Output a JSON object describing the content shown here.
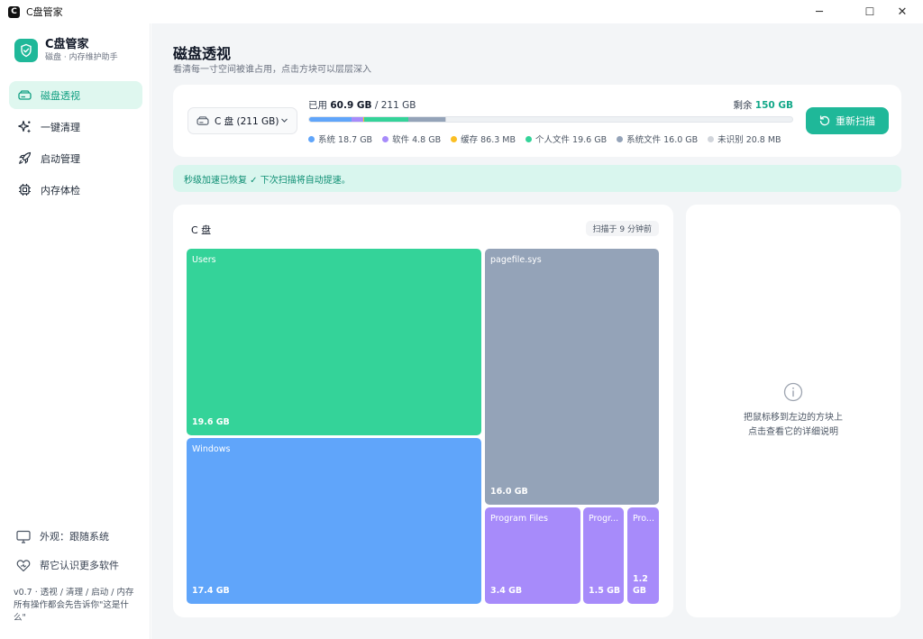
{
  "window": {
    "title": "C盘管家",
    "app_icon": "C",
    "controls": {
      "minimize": "─",
      "maximize": "☐",
      "close": "✕"
    }
  },
  "brand": {
    "name": "C盘管家",
    "subtitle": "磁盘 · 内存维护助手",
    "logo_icon": "shield-check-icon",
    "accent": "#1fb899"
  },
  "sidebar": {
    "items": [
      {
        "label": "磁盘透视",
        "icon": "drive-icon",
        "active": true
      },
      {
        "label": "一键清理",
        "icon": "sparkle-icon",
        "active": false
      },
      {
        "label": "启动管理",
        "icon": "rocket-icon",
        "active": false
      },
      {
        "label": "内存体检",
        "icon": "chip-icon",
        "active": false
      }
    ],
    "footer": [
      {
        "label": "外观：跟随系统",
        "icon": "monitor-icon"
      },
      {
        "label": "帮它认识更多软件",
        "icon": "heart-icon"
      }
    ],
    "version": "v0.7 · 透视 / 清理 / 启动 / 内存",
    "note": "所有操作都会先告诉你\"这是什么\""
  },
  "page": {
    "title": "磁盘透视",
    "subtitle": "看清每一寸空间被谁占用，点击方块可以层层深入"
  },
  "disk": {
    "drive_label": "C 盘 (211 GB)",
    "used_prefix": "已用",
    "used_value": "60.9 GB",
    "total_text": "/ 211 GB",
    "free_prefix": "剩余",
    "free_value": "150 GB",
    "rescan_label": "重新扫描",
    "categories": [
      {
        "label": "系统 18.7 GB",
        "color": "#60a5fa",
        "fraction": 0.0886
      },
      {
        "label": "软件 4.8 GB",
        "color": "#a78bfa",
        "fraction": 0.0227
      },
      {
        "label": "缓存 86.3 MB",
        "color": "#fbbf24",
        "fraction": 0.0004
      },
      {
        "label": "个人文件 19.6 GB",
        "color": "#34d399",
        "fraction": 0.0929
      },
      {
        "label": "系统文件 16.0 GB",
        "color": "#94a3b8",
        "fraction": 0.0758
      },
      {
        "label": "未识别 20.8 MB",
        "color": "#d1d5db",
        "fraction": 0.0001
      }
    ]
  },
  "notice": "秒级加速已恢复 ✓ 下次扫描将自动提速。",
  "treemap": {
    "title": "C 盘",
    "scan_time": "扫描于 9 分钟前",
    "tiles": [
      {
        "name": "Users",
        "size": "19.6 GB",
        "color": "#34d399"
      },
      {
        "name": "Windows",
        "size": "17.4 GB",
        "color": "#60a5fa"
      },
      {
        "name": "pagefile.sys",
        "size": "16.0 GB",
        "color": "#94a3b8"
      },
      {
        "name": "Program Files",
        "size": "3.4 GB",
        "color": "#a78bfa"
      },
      {
        "name": "Progr...",
        "size": "1.5 GB",
        "color": "#a78bfa"
      },
      {
        "name": "Pro...",
        "size": "1.2 GB",
        "color": "#a78bfa"
      }
    ]
  },
  "detail": {
    "icon": "info-icon",
    "line1": "把鼠标移到左边的方块上",
    "line2": "点击查看它的详细说明"
  }
}
